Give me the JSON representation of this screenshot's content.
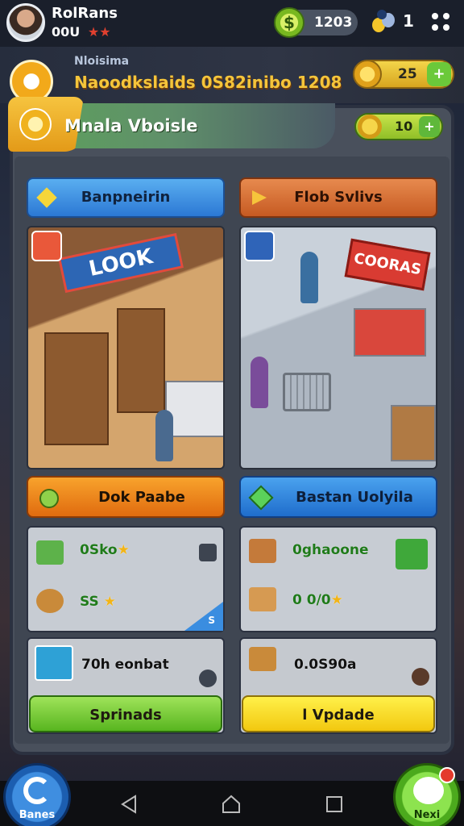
{
  "player": {
    "name": "RolRans",
    "level": "00U",
    "stars": "★★"
  },
  "currency": {
    "coins": "1203",
    "gems": "1"
  },
  "subheader": {
    "small_label": "Nloisima",
    "title": "Naoodkslaids 0S82inibo 1208",
    "cash": "25",
    "plus": "+"
  },
  "panel": {
    "title": "Mnala Vboisle",
    "coins": "10",
    "plus": "+"
  },
  "tabs": [
    {
      "label": "Banpneirin"
    },
    {
      "label": "Flob Svlivs"
    }
  ],
  "scenes": {
    "left_sign": "LOOK",
    "right_sign": "COORAS"
  },
  "action_buttons": [
    {
      "label": "Dok Paabe"
    },
    {
      "label": "Bastan Uolyila"
    }
  ],
  "stats_left": [
    {
      "value": "0Sko",
      "star": "★"
    },
    {
      "value": "SS",
      "star": "★"
    }
  ],
  "stats_left_corner": "S",
  "stats_right": [
    {
      "value": "0ghaoone"
    },
    {
      "value": "0 0/0",
      "star": "★"
    }
  ],
  "bottom_cards": [
    {
      "text": "70h eonbat",
      "button": "Sprinads"
    },
    {
      "text": "0.0S90a",
      "button": "l Vpdade"
    }
  ],
  "fab_left_label": "Banes",
  "fab_right_label": "Nexi",
  "colors": {
    "accent_green": "#58b51f",
    "accent_orange": "#e06b0f",
    "accent_blue": "#1f6dcc",
    "accent_yellow": "#f2c80f"
  }
}
